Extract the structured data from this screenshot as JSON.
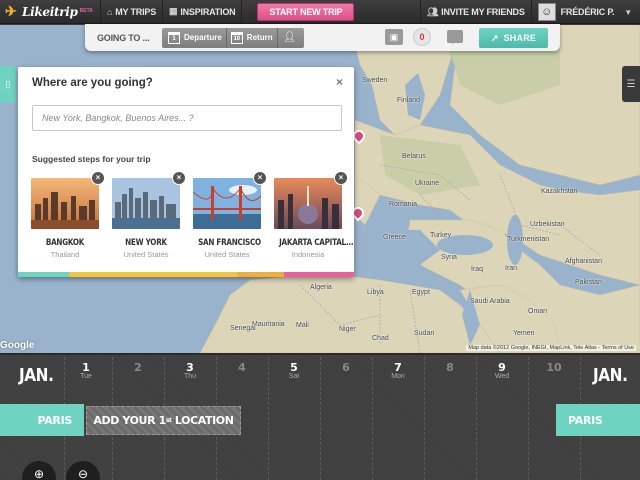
{
  "nav": {
    "logo_text": "Likeitrip",
    "logo_beta": "BETA",
    "my_trips": "MY TRIPS",
    "inspiration": "INSPIRATION",
    "start_new_trip": "START NEW TRIP",
    "invite_friends": "INVITE MY FRIENDS",
    "user_name": "FRÉDÉRIC P."
  },
  "toolbar": {
    "going_to": "GOING TO ...",
    "departure_label": "Departure",
    "departure_icon_num": "1",
    "return_label": "Return",
    "return_icon_num": "10",
    "notification_count": "0",
    "share_label": "SHARE"
  },
  "panel": {
    "title": "Where are you going?",
    "close": "×",
    "input_placeholder": "New York, Bangkok, Buenos Aires... ?",
    "input_value": "",
    "suggested_title": "Suggested steps for your trip",
    "cards": [
      {
        "city": "BANGKOK",
        "country": "Thailand"
      },
      {
        "city": "NEW YORK",
        "country": "United States"
      },
      {
        "city": "SAN FRANCISCO",
        "country": "United States"
      },
      {
        "city": "JAKARTA CAPITAL...",
        "country": "Indonesia"
      }
    ],
    "colorbar": [
      "#6fd3c2",
      "#f3c43e",
      "#f3c43e",
      "#f3c43e",
      "#f0ad3a",
      "#e8609b"
    ]
  },
  "map": {
    "labels": {
      "sweden": "Sweden",
      "finland": "Finland",
      "belarus": "Belarus",
      "ukraine": "Ukraine",
      "kazakhstan": "Kazakhstan",
      "romania": "Romania",
      "greece": "Greece",
      "turkey": "Turkey",
      "uzbekistan": "Uzbekistan",
      "turkmenistan": "Turkmenistan",
      "syria": "Syria",
      "iraq": "Iraq",
      "iran": "Iran",
      "afghanistan": "Afghanistan",
      "pakistan": "Pakistan",
      "algeria": "Algeria",
      "libya": "Libya",
      "egypt": "Egypt",
      "saudi_arabia": "Saudi Arabia",
      "oman": "Oman",
      "mauritania": "Mauritania",
      "mali": "Mali",
      "niger": "Niger",
      "chad": "Chad",
      "sudan": "Sudan",
      "yemen": "Yemen",
      "senegal": "Senegal"
    },
    "attribution": "Map data ©2012 Google, INEGI, MapLink, Tele Atlas - Terms of Use",
    "google": "Google"
  },
  "timeline": {
    "month_left": "JAN.",
    "month_right": "JAN.",
    "days": [
      {
        "num": "1",
        "dow": "Tue"
      },
      {
        "num": "2",
        "dow": ""
      },
      {
        "num": "3",
        "dow": "Thu"
      },
      {
        "num": "4",
        "dow": ""
      },
      {
        "num": "5",
        "dow": "Sat"
      },
      {
        "num": "6",
        "dow": ""
      },
      {
        "num": "7",
        "dow": "Mon"
      },
      {
        "num": "8",
        "dow": ""
      },
      {
        "num": "9",
        "dow": "Wed"
      },
      {
        "num": "10",
        "dow": ""
      }
    ],
    "start_city": "PARIS",
    "end_city": "PARIS",
    "add_location_pre": "ADD YOUR 1",
    "add_location_sup": "st",
    "add_location_post": " LOCATION"
  }
}
